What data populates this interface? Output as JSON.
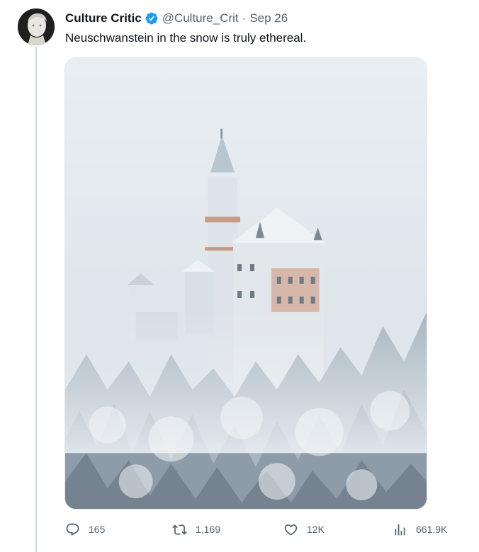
{
  "tweet": {
    "author_name": "Culture Critic",
    "handle": "@Culture_Crit",
    "separator": "·",
    "date": "Sep 26",
    "text": "Neuschwanstein in the snow is truly ethereal."
  },
  "actions": {
    "replies": "165",
    "reposts": "1,169",
    "likes": "12K",
    "views": "661.9K"
  },
  "icons": {
    "verified": "verified-badge-icon",
    "reply": "reply-icon",
    "repost": "repost-icon",
    "like": "heart-icon",
    "views": "analytics-icon"
  },
  "colors": {
    "verified": "#1d9bf0",
    "muted_text": "#536471",
    "primary_text": "#0f1419"
  }
}
